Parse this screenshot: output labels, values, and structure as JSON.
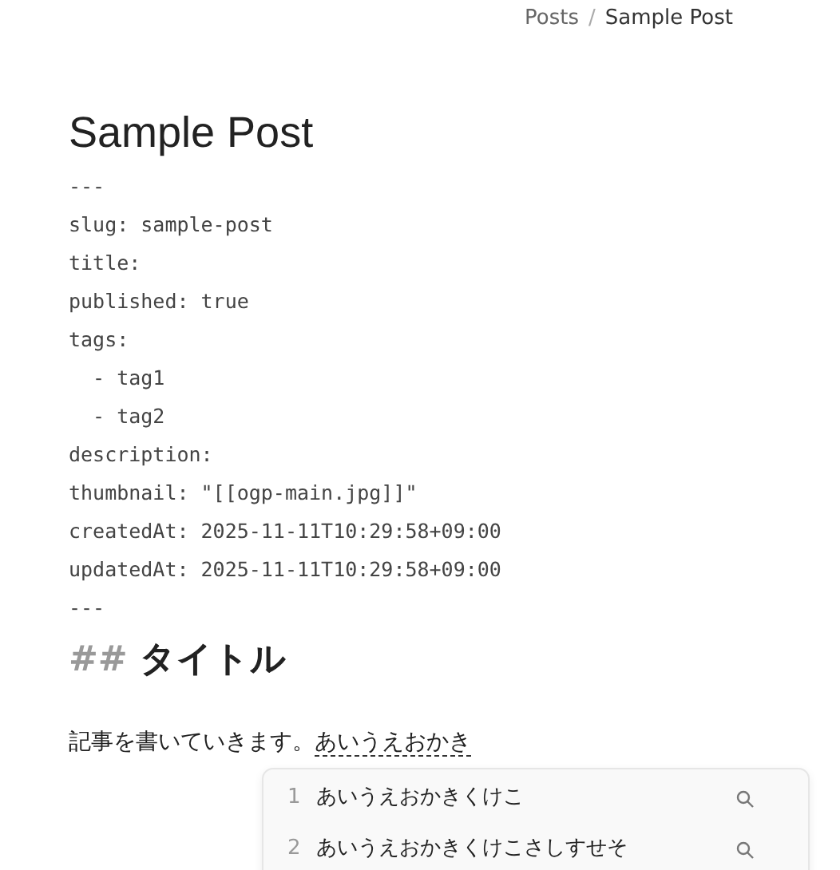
{
  "breadcrumb_separator": "/",
  "breadcrumb": [
    {
      "label": "Posts",
      "current": false
    },
    {
      "label": "Sample Post",
      "current": true
    }
  ],
  "title": "Sample Post",
  "frontmatter": [
    "---",
    "slug: sample-post",
    "title:",
    "published: true",
    "tags:",
    "  - tag1",
    "  - tag2",
    "description:",
    "thumbnail: \"[[ogp-main.jpg]]\"",
    "createdAt: 2025-11-11T10:29:58+09:00",
    "updatedAt: 2025-11-11T10:29:58+09:00",
    "---"
  ],
  "heading": {
    "marker": "##",
    "text": "タイトル"
  },
  "paragraph": {
    "text": "記事を書いていきます。",
    "composing": "あいうえおかき"
  },
  "candidates": [
    {
      "number": "1",
      "text": "あいうえおかきくけこ"
    },
    {
      "number": "2",
      "text": "あいうえおかきくけこさしすせそ"
    }
  ]
}
